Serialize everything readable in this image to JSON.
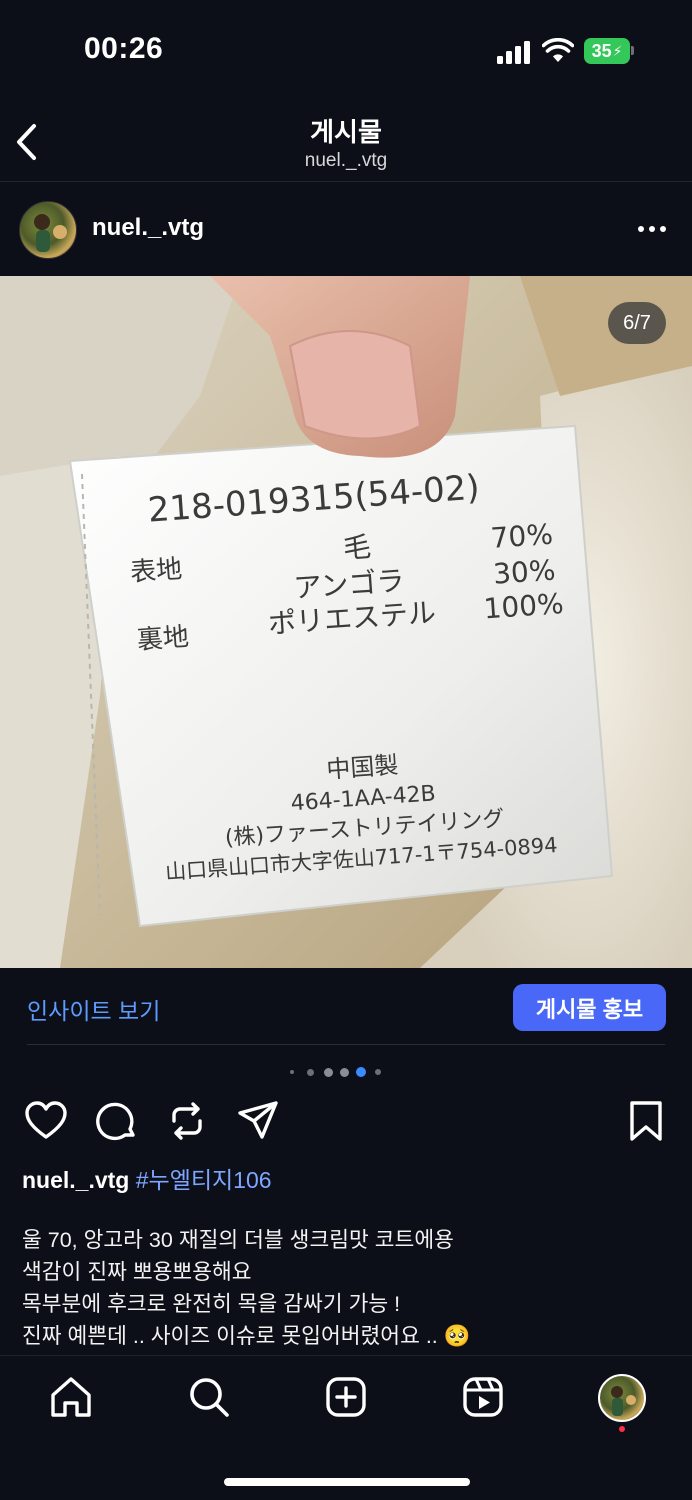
{
  "status_bar": {
    "time": "00:26",
    "battery": "35"
  },
  "header": {
    "title": "게시물",
    "subtitle": "nuel._.vtg"
  },
  "post": {
    "author": "nuel._.vtg",
    "image_counter": "6/7",
    "label_text": {
      "code": "218-019315(54-02)",
      "row1_label": "表地",
      "row1_item1": "毛",
      "row1_pct1": "70%",
      "row1_item2": "アンゴラ",
      "row1_pct2": "30%",
      "row2_label": "裏地",
      "row2_item": "ポリエステル",
      "row2_pct": "100%",
      "origin": "中国製",
      "number": "464-1AA-42B",
      "company": "(株)ファーストリテイリング",
      "address": "山口県山口市大字佐山717-1〒754-0894"
    },
    "insight_label": "인사이트 보기",
    "promote_label": "게시물 홍보",
    "caption_user": "nuel._.vtg",
    "caption_tag": "#누엘티지106",
    "caption_lines": [
      "울 70, 앙고라 30 재질의 더블 생크림맛 코트에용",
      "색감이 진짜 뽀용뽀용해요",
      "목부분에 후크로 완전히 목을 감싸기 가능 !",
      "진짜 예쁜데 .. 사이즈 이슈로 못입어버렸어요 .. 🥺"
    ]
  },
  "colors": {
    "background": "#0c0f17",
    "accent_link": "#5f9bff",
    "promote_button": "#4a68f7",
    "battery": "#34c759"
  },
  "icons": [
    "back-chevron-icon",
    "more-dots-icon",
    "heart-icon",
    "comment-icon",
    "repost-icon",
    "share-icon",
    "bookmark-icon",
    "home-icon",
    "search-icon",
    "create-icon",
    "reels-icon",
    "profile-icon"
  ]
}
